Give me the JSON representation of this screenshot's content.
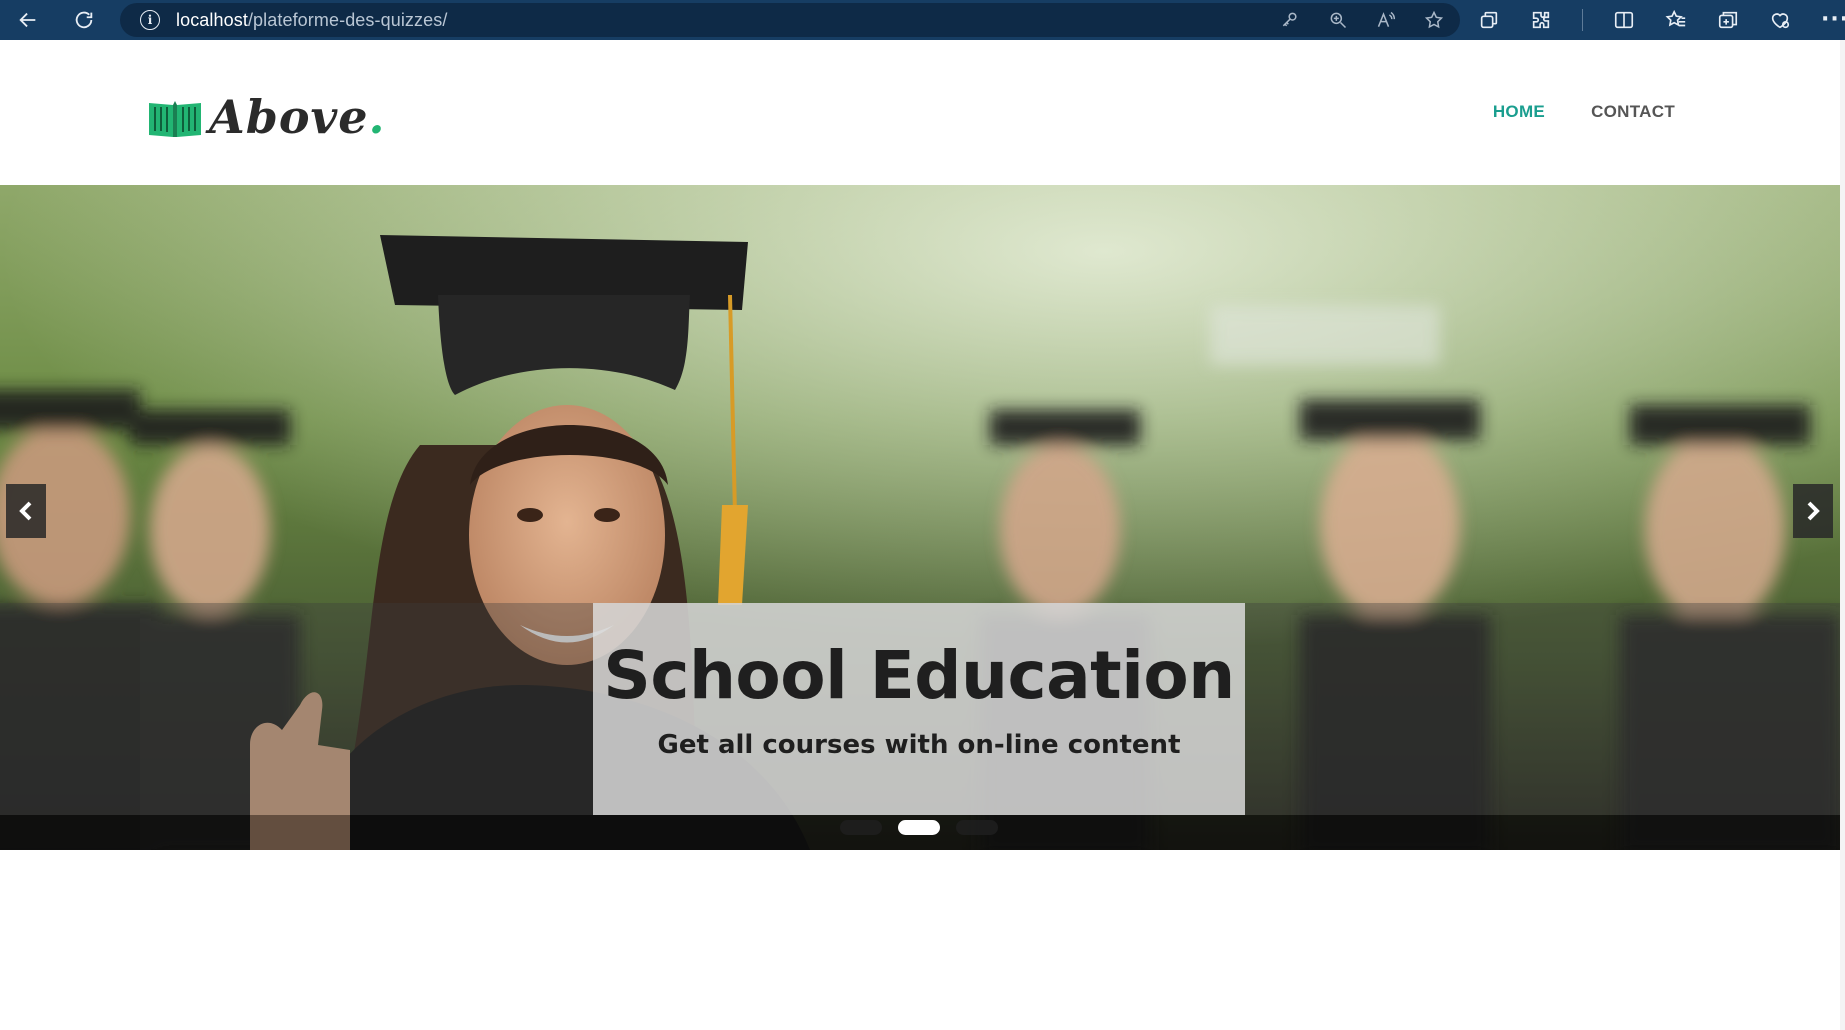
{
  "browser": {
    "url_host": "localhost",
    "url_path": "/plateforme-des-quizzes/"
  },
  "header": {
    "logo_text": "Above",
    "logo_dot": ".",
    "nav": [
      {
        "label": "HOME",
        "active": true
      },
      {
        "label": "CONTACT",
        "active": false
      }
    ]
  },
  "slider": {
    "title": "School Education",
    "subtitle": "Get all courses with on-line content",
    "slide_count": 3,
    "active_slide": 2
  },
  "colors": {
    "accent": "#1a9e8f",
    "logo_green": "#22b573",
    "browser_bar": "#163d63"
  }
}
